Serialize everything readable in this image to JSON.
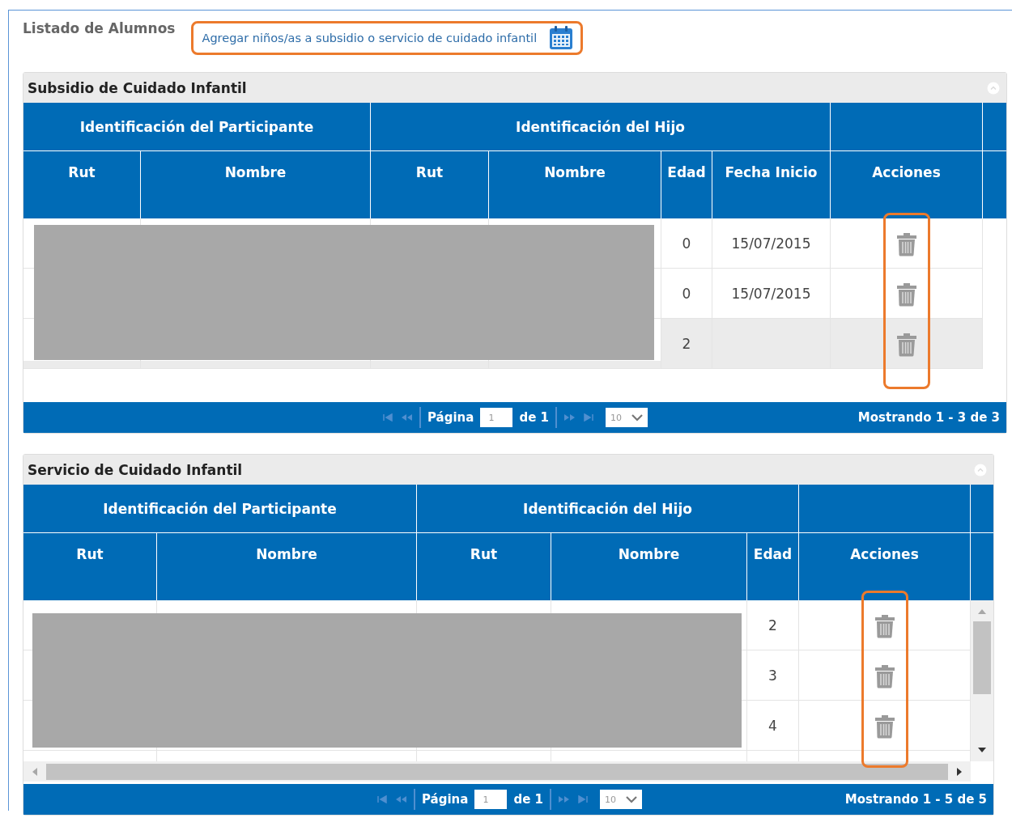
{
  "page_title": "Listado de Alumnos",
  "add_link": "Agregar niños/as a subsidio o servicio de cuidado infantil",
  "panels": [
    {
      "title": "Subsidio de Cuidado Infantil",
      "kind": "plain",
      "redacted": true,
      "groups": [
        "Identificación del Participante",
        "Identificación del Hijo"
      ],
      "columns": [
        {
          "label": "Rut",
          "kind": "text"
        },
        {
          "label": "Nombre",
          "kind": "text"
        },
        {
          "label": "Rut",
          "kind": "text"
        },
        {
          "label": "Nombre",
          "kind": "text"
        },
        {
          "label": "Edad",
          "kind": "edad"
        },
        {
          "label": "Fecha Inicio",
          "kind": "fecha"
        },
        {
          "label": "Acciones",
          "kind": "acciones"
        }
      ],
      "rows": [
        {
          "edad": "0",
          "fecha_inicio": "15/07/2015",
          "selected": false
        },
        {
          "edad": "0",
          "fecha_inicio": "15/07/2015",
          "selected": false
        },
        {
          "edad": "2",
          "selected": true
        }
      ],
      "pager": {
        "page_label": "Página",
        "page": "1",
        "of": "de 1",
        "page_size": "10",
        "summary": "Mostrando 1 - 3 de 3"
      }
    },
    {
      "title": "Servicio de Cuidado Infantil",
      "kind": "scroll",
      "redacted": true,
      "groups": [
        "Identificación del Participante",
        "Identificación del Hijo"
      ],
      "columns": [
        {
          "label": "Rut",
          "kind": "text"
        },
        {
          "label": "Nombre",
          "kind": "text"
        },
        {
          "label": "Rut",
          "kind": "text"
        },
        {
          "label": "Nombre",
          "kind": "text"
        },
        {
          "label": "Edad",
          "kind": "edad"
        },
        {
          "label": "Acciones",
          "kind": "acciones"
        }
      ],
      "rows": [
        {
          "edad": "2",
          "selected": false
        },
        {
          "edad": "3",
          "selected": false
        },
        {
          "edad": "4",
          "selected": false
        }
      ],
      "pager": {
        "page_label": "Página",
        "page": "1",
        "of": "de 1",
        "page_size": "10",
        "summary": "Mostrando 1 - 5 de 5"
      }
    }
  ]
}
